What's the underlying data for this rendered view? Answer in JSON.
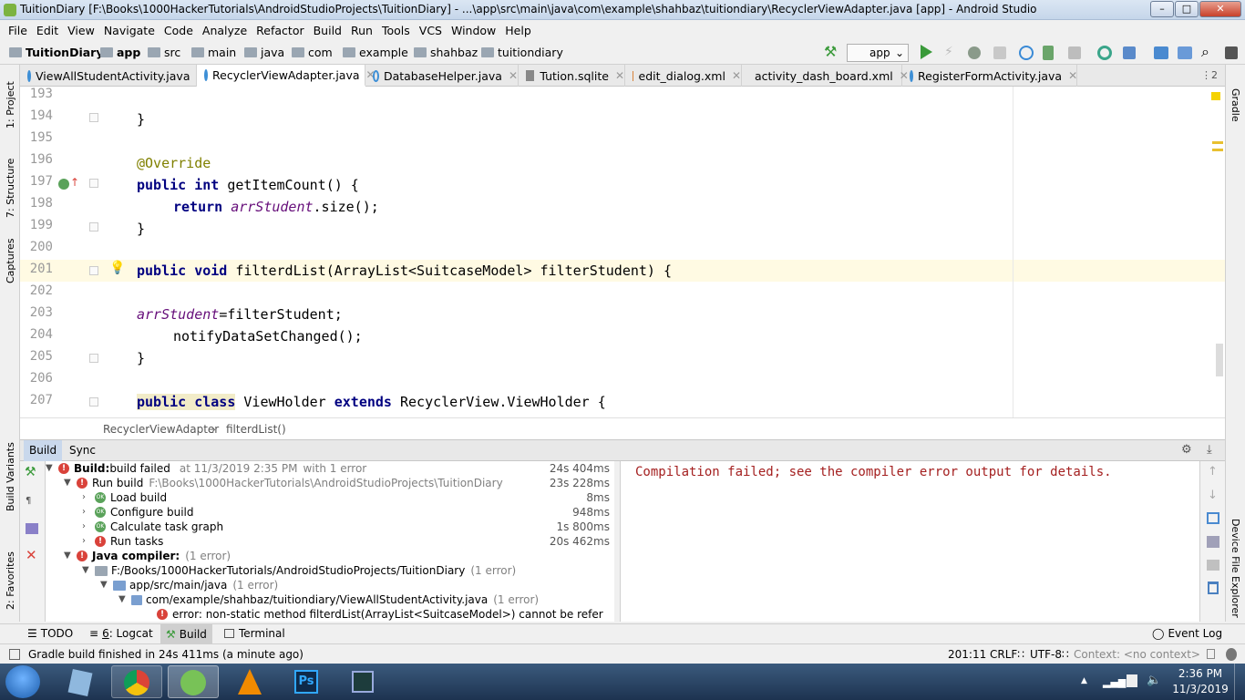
{
  "window": {
    "title": "TuitionDiary [F:\\Books\\1000HackerTutorials\\AndroidStudioProjects\\TuitionDiary] - ...\\app\\src\\main\\java\\com\\example\\shahbaz\\tuitiondiary\\RecyclerViewAdapter.java [app] - Android Studio"
  },
  "menu": [
    "File",
    "Edit",
    "View",
    "Navigate",
    "Code",
    "Analyze",
    "Refactor",
    "Build",
    "Run",
    "Tools",
    "VCS",
    "Window",
    "Help"
  ],
  "breadcrumb": [
    "TuitionDiary",
    "app",
    "src",
    "main",
    "java",
    "com",
    "example",
    "shahbaz",
    "tuitiondiary"
  ],
  "run_config": "app",
  "tabs": [
    "ViewAllStudentActivity.java",
    "RecyclerViewAdapter.java",
    "DatabaseHelper.java",
    "Tution.sqlite",
    "edit_dialog.xml",
    "activity_dash_board.xml",
    "RegisterFormActivity.java"
  ],
  "tabs_overflow": "⋮2",
  "left_strip": [
    "1: Project",
    "7: Structure",
    "Captures",
    "Build Variants",
    "2: Favorites"
  ],
  "right_strip": [
    "Gradle",
    "Device File Explorer"
  ],
  "code": {
    "lines": [
      "193",
      "194",
      "195",
      "196",
      "197",
      "198",
      "199",
      "200",
      "201",
      "202",
      "203",
      "204",
      "205",
      "206",
      "207"
    ],
    "l194": "}",
    "l196": "@Override",
    "l197_kw": "public int",
    "l197_rest": " getItemCount() {",
    "l198_kw": "return",
    "l198_fld": "arrStudent",
    "l198_rest": ".size();",
    "l199": "}",
    "l201_kw": "public void",
    "l201_rest": " filterdList(ArrayList<SuitcaseModel> filterStudent) {",
    "l203_fld": "arrStudent",
    "l203_rest": "=filterStudent;",
    "l204": "notifyDataSetChanged();",
    "l205": "}",
    "l207_kw1": "public class",
    "l207_mid": " ViewHolder ",
    "l207_kw2": "extends",
    "l207_rest": " RecyclerView.ViewHolder {"
  },
  "editor_breadcrumb": {
    "cls": "RecyclerViewAdapter",
    "method": "filterdList()"
  },
  "build_panel": {
    "tabs": [
      "Build",
      "Sync"
    ],
    "tree": [
      {
        "label": "Build:",
        "label2": " build failed",
        "extra": "at 11/3/2019 2:35 PM",
        "extra2": "with 1 error",
        "time": "24s 404ms"
      },
      {
        "label": "Run build",
        "extra": "F:\\Books\\1000HackerTutorials\\AndroidStudioProjects\\TuitionDiary",
        "time": "23s 228ms"
      },
      {
        "label": "Load build",
        "time": "8ms"
      },
      {
        "label": "Configure build",
        "time": "948ms"
      },
      {
        "label": "Calculate task graph",
        "time": "1s 800ms"
      },
      {
        "label": "Run tasks",
        "time": "20s 462ms"
      },
      {
        "label": "Java compiler:",
        "extra": "(1 error)"
      },
      {
        "label": "F:/Books/1000HackerTutorials/AndroidStudioProjects/TuitionDiary",
        "extra": "(1 error)"
      },
      {
        "label": "app/src/main/java",
        "extra": "(1 error)"
      },
      {
        "label": "com/example/shahbaz/tuitiondiary/ViewAllStudentActivity.java",
        "extra": "(1 error)"
      },
      {
        "label": "error: non-static method filterdList(ArrayList<SuitcaseModel>) cannot be refer"
      }
    ],
    "output": "Compilation failed; see the compiler error output for details."
  },
  "toolwindows": {
    "todo": "TODO",
    "logcat_num": "6",
    "logcat": ": Logcat",
    "build": "Build",
    "terminal": "Terminal",
    "event_log": "Event Log"
  },
  "status": {
    "message": "Gradle build finished in 24s 411ms (a minute ago)",
    "position": "201:11",
    "line_sep": "CRLF∷",
    "encoding": "UTF-8∷",
    "context": "Context: <no context>"
  },
  "clock": {
    "time": "2:36 PM",
    "date": "11/3/2019"
  },
  "colors": {
    "keyword": "#000080",
    "field": "#660e7a",
    "annotation": "#808000",
    "error": "#d9423a",
    "output_text": "#a42020"
  }
}
